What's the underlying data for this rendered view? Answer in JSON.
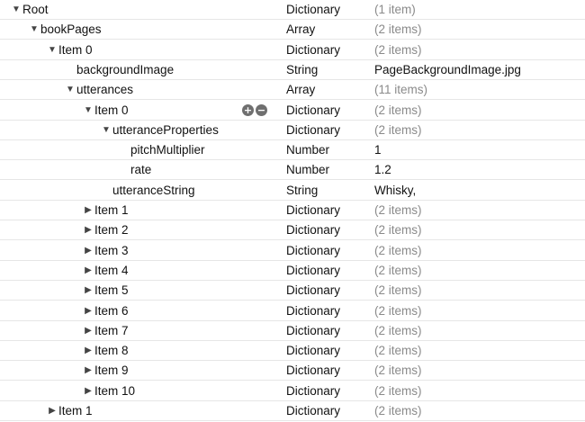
{
  "plist": {
    "rows": [
      {
        "key": "Root",
        "type": "Dictionary",
        "value": "(1 item)",
        "depth": 0,
        "disclosure": "expanded",
        "muted": true
      },
      {
        "key": "bookPages",
        "type": "Array",
        "value": "(2 items)",
        "depth": 1,
        "disclosure": "expanded",
        "muted": true
      },
      {
        "key": "Item 0",
        "type": "Dictionary",
        "value": "(2 items)",
        "depth": 2,
        "disclosure": "expanded",
        "muted": true
      },
      {
        "key": "backgroundImage",
        "type": "String",
        "value": "PageBackgroundImage.jpg",
        "depth": 3,
        "disclosure": "none",
        "muted": false
      },
      {
        "key": "utterances",
        "type": "Array",
        "value": "(11 items)",
        "depth": 3,
        "disclosure": "expanded",
        "muted": true
      },
      {
        "key": "Item 0",
        "type": "Dictionary",
        "value": "(2 items)",
        "depth": 4,
        "disclosure": "expanded",
        "muted": true,
        "controls": true
      },
      {
        "key": "utteranceProperties",
        "type": "Dictionary",
        "value": "(2 items)",
        "depth": 5,
        "disclosure": "expanded",
        "muted": true
      },
      {
        "key": "pitchMultiplier",
        "type": "Number",
        "value": "1",
        "depth": 6,
        "disclosure": "none",
        "muted": false
      },
      {
        "key": "rate",
        "type": "Number",
        "value": "1.2",
        "depth": 6,
        "disclosure": "none",
        "muted": false
      },
      {
        "key": "utteranceString",
        "type": "String",
        "value": "Whisky,",
        "depth": 5,
        "disclosure": "none",
        "muted": false
      },
      {
        "key": "Item 1",
        "type": "Dictionary",
        "value": "(2 items)",
        "depth": 4,
        "disclosure": "collapsed",
        "muted": true
      },
      {
        "key": "Item 2",
        "type": "Dictionary",
        "value": "(2 items)",
        "depth": 4,
        "disclosure": "collapsed",
        "muted": true
      },
      {
        "key": "Item 3",
        "type": "Dictionary",
        "value": "(2 items)",
        "depth": 4,
        "disclosure": "collapsed",
        "muted": true
      },
      {
        "key": "Item 4",
        "type": "Dictionary",
        "value": "(2 items)",
        "depth": 4,
        "disclosure": "collapsed",
        "muted": true
      },
      {
        "key": "Item 5",
        "type": "Dictionary",
        "value": "(2 items)",
        "depth": 4,
        "disclosure": "collapsed",
        "muted": true
      },
      {
        "key": "Item 6",
        "type": "Dictionary",
        "value": "(2 items)",
        "depth": 4,
        "disclosure": "collapsed",
        "muted": true
      },
      {
        "key": "Item 7",
        "type": "Dictionary",
        "value": "(2 items)",
        "depth": 4,
        "disclosure": "collapsed",
        "muted": true
      },
      {
        "key": "Item 8",
        "type": "Dictionary",
        "value": "(2 items)",
        "depth": 4,
        "disclosure": "collapsed",
        "muted": true
      },
      {
        "key": "Item 9",
        "type": "Dictionary",
        "value": "(2 items)",
        "depth": 4,
        "disclosure": "collapsed",
        "muted": true
      },
      {
        "key": "Item 10",
        "type": "Dictionary",
        "value": "(2 items)",
        "depth": 4,
        "disclosure": "collapsed",
        "muted": true
      },
      {
        "key": "Item 1",
        "type": "Dictionary",
        "value": "(2 items)",
        "depth": 2,
        "disclosure": "collapsed",
        "muted": true
      }
    ],
    "row_controls": {
      "add_icon": "plus-circle-icon",
      "remove_icon": "minus-circle-icon",
      "add_glyph": "+",
      "remove_glyph": "−"
    },
    "disclosure_glyphs": {
      "expanded": "▼",
      "collapsed": "▶"
    },
    "colors": {
      "text": "#111111",
      "muted_value": "#8a8a8a",
      "row_divider": "#e6e6e6",
      "control": "#6f6f6f"
    }
  }
}
